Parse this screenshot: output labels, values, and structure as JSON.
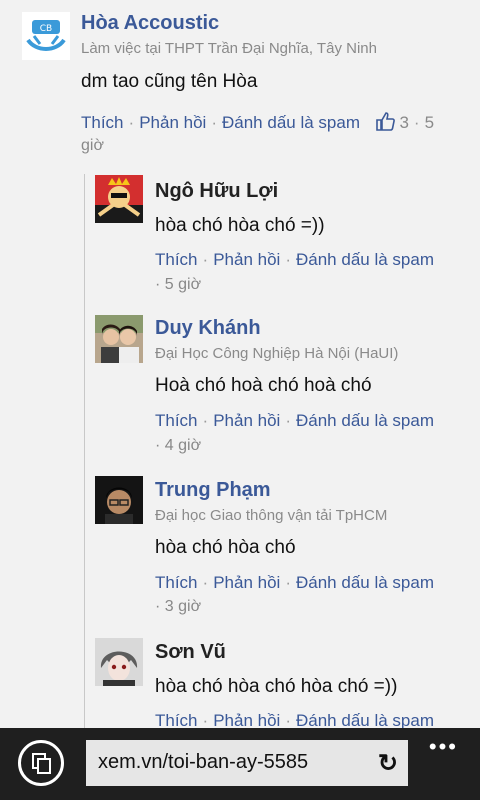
{
  "comments": [
    {
      "name": "Hòa Accoustic",
      "subtitle": "Làm việc tại THPT Trần Đại Nghĩa, Tây Ninh",
      "text": "dm tao cũng tên Hòa",
      "actions": [
        "Thích",
        "Phản hồi",
        "Đánh dấu là spam"
      ],
      "likes": "3",
      "time_part1": "5",
      "time_part2": "giờ"
    },
    {
      "name": "Ngô Hữu Lợi",
      "text": "hòa chó hòa chó =))",
      "actions": [
        "Thích",
        "Phản hồi",
        "Đánh dấu là spam"
      ],
      "time": "· 5 giờ"
    },
    {
      "name": "Duy Khánh",
      "subtitle": "Đại Học Công Nghiệp Hà Nội (HaUI)",
      "text": "Hoà chó hoà chó hoà chó",
      "actions": [
        "Thích",
        "Phản hồi",
        "Đánh dấu là spam"
      ],
      "time": "· 4 giờ"
    },
    {
      "name": "Trung Phạm",
      "subtitle": "Đại học Giao thông vận tải TpHCM",
      "text": "hòa chó hòa chó",
      "actions": [
        "Thích",
        "Phản hồi",
        "Đánh dấu là spam"
      ],
      "time": "· 3 giờ"
    },
    {
      "name": "Sơn Vũ",
      "text": "hòa chó hòa chó hòa chó =))",
      "actions": [
        "Thích",
        "Phản hồi",
        "Đánh dấu là spam"
      ]
    }
  ],
  "browser": {
    "url": "xem.vn/toi-ban-ay-5585",
    "refresh_icon": "refresh-icon",
    "more_icon": "more-icon",
    "tabs_icon": "tabs-icon"
  },
  "colors": {
    "link": "#3b5998",
    "background": "#f2f2f2",
    "bottom_bar": "#1f1f1f"
  }
}
